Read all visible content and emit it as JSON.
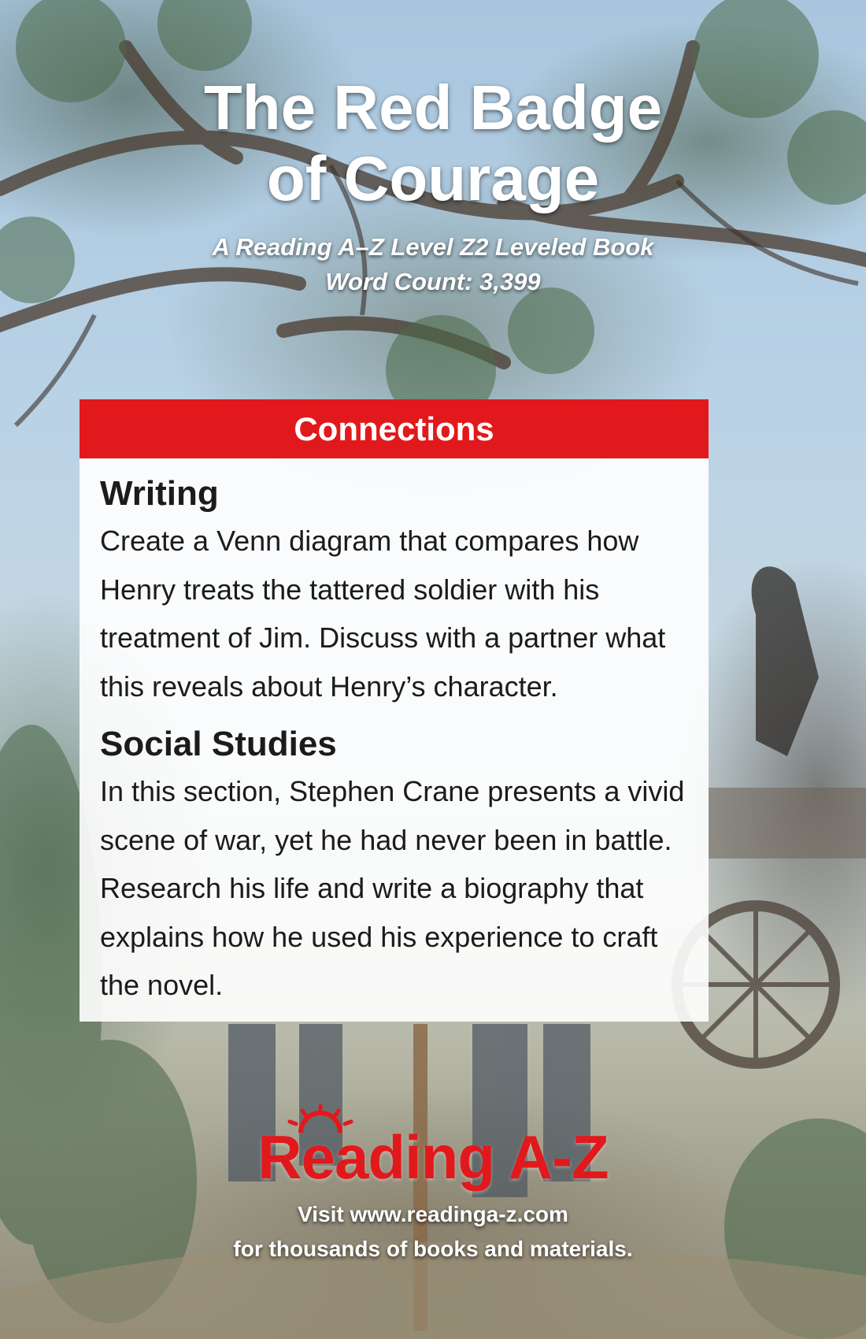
{
  "cover": {
    "title_line1": "The Red Badge",
    "title_line2": "of Courage",
    "subtitle_line1": "A Reading A–Z Level Z2 Leveled Book",
    "subtitle_line2": "Word Count: 3,399"
  },
  "connections": {
    "header": "Connections",
    "sections": [
      {
        "heading": "Writing",
        "text": "Create a Venn diagram that compares how Henry treats the tattered soldier with his treatment of Jim. Discuss with a partner what this reveals about Henry’s character."
      },
      {
        "heading": "Social Studies",
        "text": "In this section, Stephen Crane presents a vivid scene of war, yet he had never been in battle. Research his life and write a biography that explains how he used his experience to craft the novel."
      }
    ]
  },
  "footer": {
    "logo_text": "Reading A-Z",
    "visit_line1": "Visit www.readinga-z.com",
    "visit_line2": "for thousands of books and materials."
  },
  "colors": {
    "accent_red": "#e2191c",
    "card_background": "#ffffff",
    "title_text": "#ffffff"
  }
}
